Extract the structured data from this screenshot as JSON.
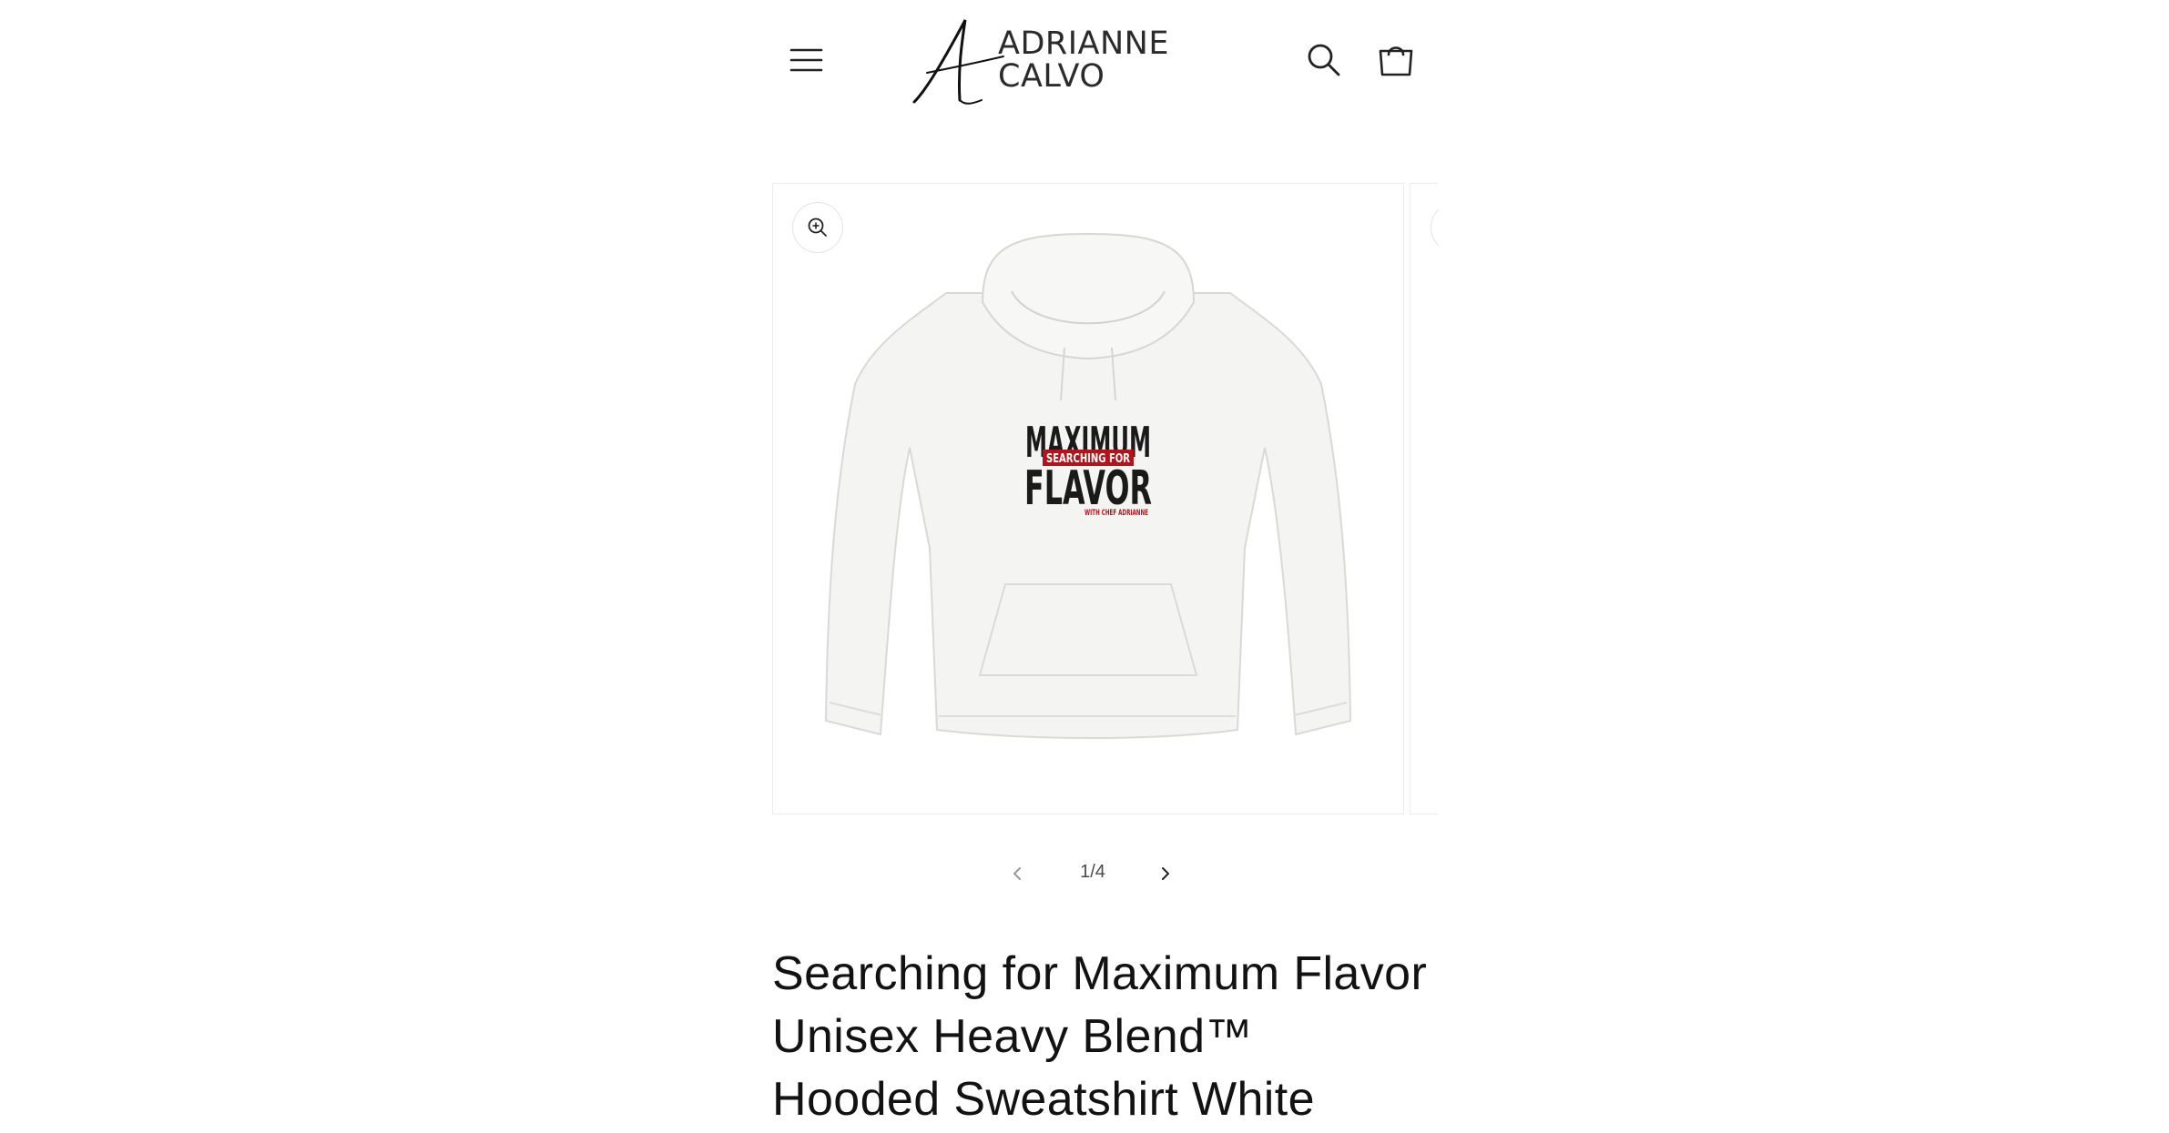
{
  "header": {
    "menu_icon": "hamburger-menu-icon",
    "logo": {
      "line1": "ADRIANNE",
      "line2": "CALVO",
      "monogram": "A"
    },
    "search_icon": "search-icon",
    "cart_icon": "cart-bag-icon"
  },
  "gallery": {
    "zoom_icon": "zoom-in-icon",
    "product_image": {
      "print": {
        "line1": "MAXIMUM",
        "banner": "SEARCHING FOR",
        "line2": "FLAVOR",
        "tagline": "WITH CHEF ADRIANNE"
      }
    },
    "pager": {
      "count": "1/4",
      "prev_icon": "chevron-left-icon",
      "next_icon": "chevron-right-icon"
    }
  },
  "product": {
    "title": "Searching for Maximum Flavor Unisex Heavy Blend™ Hooded Sweatshirt White"
  },
  "colors": {
    "text": "#121212",
    "banner_red": "#b3141c",
    "border": "#ececec"
  }
}
